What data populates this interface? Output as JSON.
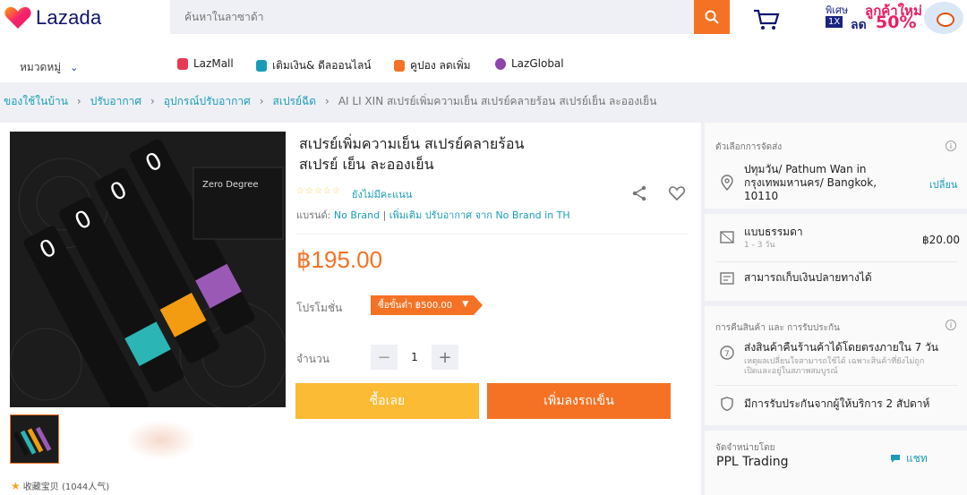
{
  "header": {
    "logo_text": "Lazada",
    "search_placeholder": "ค้นหาในลาซาด้า",
    "promo": {
      "line1": "พิเศษ",
      "line2": "ลูกค้าใหม่",
      "badge": "1X",
      "lot": "ลด",
      "percent": "50%"
    }
  },
  "nav": {
    "category": "หมวดหมู่",
    "items": [
      {
        "label": "LazMall",
        "color": "#e8384f"
      },
      {
        "label": "เติมเงิน& ดีลออนไลน์",
        "color": "#1a9cb7"
      },
      {
        "label": "คูปอง ลดเพิ่ม",
        "color": "#f57224"
      },
      {
        "label": "LazGlobal",
        "color": "#8e44ad"
      }
    ]
  },
  "breadcrumb": {
    "items": [
      "ของใช้ในบ้าน",
      "ปรับอากาศ",
      "อุปกรณ์ปรับอากาศ",
      "สเปรย์ฉีด"
    ],
    "current": "AI LI XIN สเปรย์เพิ่มความเย็น สเปรย์คลายร้อน สเปรย์เย็น ละอองเย็น"
  },
  "product": {
    "title_line1": "สเปรย์เพิ่มความเย็น สเปรย์คลายร้อน",
    "title_line2": "สเปรย์ เย็น ละอองเย็น",
    "rating_stars": "☆☆☆☆☆",
    "rating_link": "ยังไม่มีคะแนน",
    "brand_label": "แบรนด์:",
    "brand_name": "No Brand",
    "brand_more": "เพิ่มเติม ปรับอากาศ จาก No Brand in TH",
    "price": "฿195.00",
    "promo_label": "โปรโมชั่น",
    "promo_tag": "ซื้อขั้นต่ำ ฿500.00",
    "qty_label": "จำนวน",
    "qty_value": "1",
    "buy_now": "ซื้อเลย",
    "add_to_cart": "เพิ่มลงรถเข็น",
    "image_brand": "Zero Degree",
    "image_digit": "0",
    "favorites": "收藏宝贝 (1044人气)"
  },
  "delivery": {
    "section_title": "ตัวเลือกการจัดส่ง",
    "location": "ปทุมวัน/ Pathum Wan in กรุงเทพมหานคร/ Bangkok, 10110",
    "location_l1": "ปทุมวัน/ Pathum Wan in",
    "location_l2": "กรุงเทพมหานคร/ Bangkok,",
    "location_l3": "10110",
    "change": "เปลี่ยน",
    "shipping_type": "แบบธรรมดา",
    "shipping_days": "1 - 3 วัน",
    "shipping_price": "฿20.00",
    "cod": "สามารถเก็บเงินปลายทางได้"
  },
  "returns": {
    "section_title": "การคืนสินค้า และ การรับประกัน",
    "return_title": "ส่งสินค้าคืนร้านค้าได้โดยตรงภายใน 7 วัน",
    "return_sub1": "เหตุผลเปลี่ยนใจสามารถใช้ได้ เฉพาะสินค้าที่ยังไม่ถูก",
    "return_sub2": "เปิดและอยู่ในสภาพสมบูรณ์",
    "warranty": "มีการรับประกันจากผู้ให้บริการ 2 สัปดาห์"
  },
  "seller": {
    "section_title": "จัดจำหน่ายโดย",
    "name": "PPL Trading",
    "chat": "แชท"
  }
}
